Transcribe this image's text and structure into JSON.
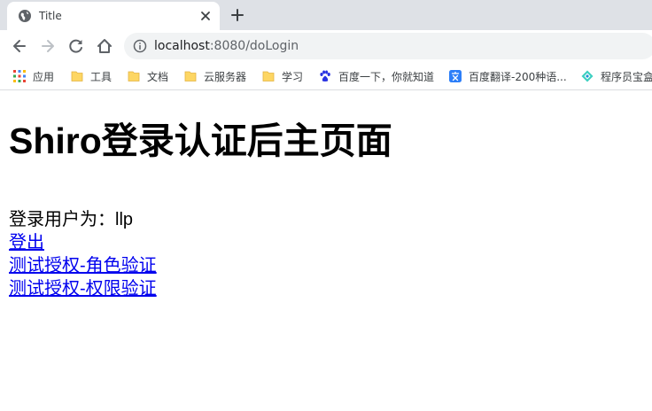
{
  "browser": {
    "tab": {
      "title": "Title"
    },
    "address": {
      "host": "localhost",
      "path": ":8080/doLogin"
    },
    "bookmarks": [
      {
        "label": "应用",
        "icon": "apps-grid-icon"
      },
      {
        "label": "工具",
        "icon": "folder-icon"
      },
      {
        "label": "文档",
        "icon": "folder-icon"
      },
      {
        "label": "云服务器",
        "icon": "folder-icon"
      },
      {
        "label": "学习",
        "icon": "folder-icon"
      },
      {
        "label": "百度一下，你就知道",
        "icon": "baidu-paw-icon"
      },
      {
        "label": "百度翻译-200种语...",
        "icon": "translate-icon"
      },
      {
        "label": "程序员宝盒",
        "icon": "diamond-icon"
      }
    ]
  },
  "page": {
    "heading": "Shiro登录认证后主页面",
    "user_line": "登录用户为：llp",
    "links": {
      "logout": "登出",
      "role_test": "测试授权-角色验证",
      "permission_test": "测试授权-权限验证"
    }
  },
  "colors": {
    "link": "#0000ee",
    "tabstrip": "#dee1e6",
    "omnibox": "#f1f3f4",
    "folder": "#fdd663"
  }
}
